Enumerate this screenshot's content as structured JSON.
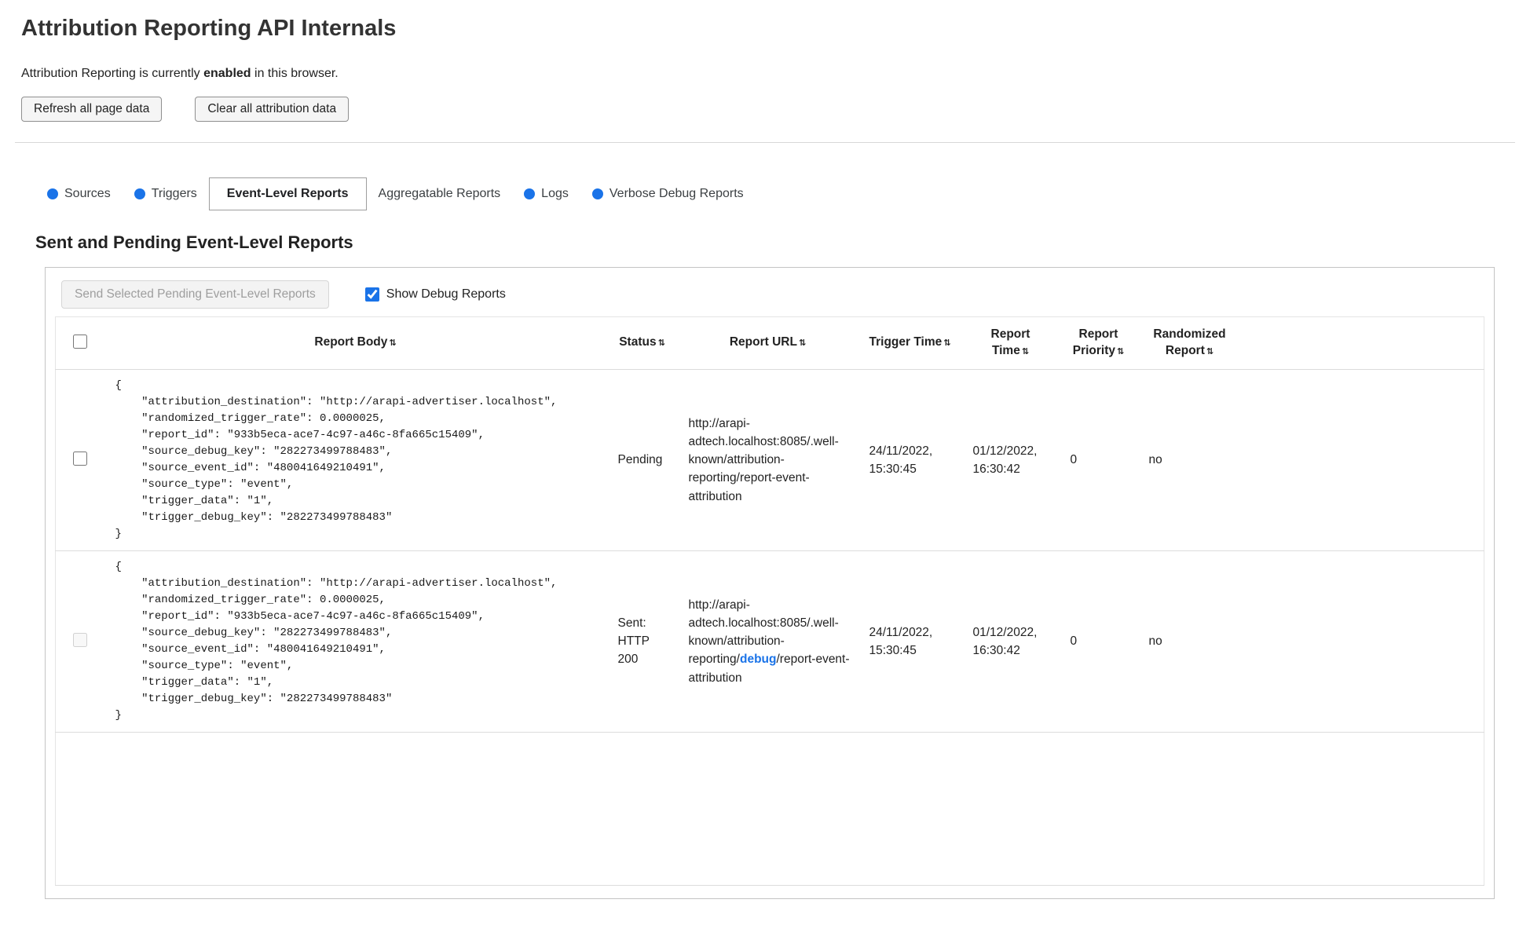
{
  "page": {
    "title": "Attribution Reporting API Internals",
    "status": {
      "prefix": "Attribution Reporting is currently ",
      "bold": "enabled",
      "suffix": " in this browser."
    },
    "buttons": {
      "refresh": "Refresh all page data",
      "clear": "Clear all attribution data"
    }
  },
  "tabs": [
    {
      "label": "Sources"
    },
    {
      "label": "Triggers"
    },
    {
      "label": "Event-Level Reports"
    },
    {
      "label": "Aggregatable Reports"
    },
    {
      "label": "Logs"
    },
    {
      "label": "Verbose Debug Reports"
    }
  ],
  "section": {
    "heading": "Sent and Pending Event-Level Reports",
    "send_button": "Send Selected Pending Event-Level Reports",
    "show_debug_label": "Show Debug Reports",
    "show_debug_checked": true
  },
  "table": {
    "headers": [
      {
        "label": "Report Body",
        "sort": "⇅"
      },
      {
        "label": "Status",
        "sort": "⇅"
      },
      {
        "label": "Report URL",
        "sort": "⇅"
      },
      {
        "label": "Trigger Time",
        "sort": "⇅"
      },
      {
        "label": "Report Time",
        "sort": "⇅"
      },
      {
        "label": "Report Priority",
        "sort": "⇅"
      },
      {
        "label": "Randomized Report",
        "sort": "⇅"
      }
    ],
    "rows": [
      {
        "body": "{\n    \"attribution_destination\": \"http://arapi-advertiser.localhost\",\n    \"randomized_trigger_rate\": 0.0000025,\n    \"report_id\": \"933b5eca-ace7-4c97-a46c-8fa665c15409\",\n    \"source_debug_key\": \"282273499788483\",\n    \"source_event_id\": \"480041649210491\",\n    \"source_type\": \"event\",\n    \"trigger_data\": \"1\",\n    \"trigger_debug_key\": \"282273499788483\"\n}",
        "status": "Pending",
        "url_prefix": "http://arapi-adtech.localhost:8085/.well-known/attribution-reporting/report-event-attribution",
        "url_debug": "",
        "url_suffix": "",
        "trigger_time": "24/11/2022, 15:30:45",
        "report_time": "01/12/2022, 16:30:42",
        "priority": "0",
        "randomized": "no"
      },
      {
        "body": "{\n    \"attribution_destination\": \"http://arapi-advertiser.localhost\",\n    \"randomized_trigger_rate\": 0.0000025,\n    \"report_id\": \"933b5eca-ace7-4c97-a46c-8fa665c15409\",\n    \"source_debug_key\": \"282273499788483\",\n    \"source_event_id\": \"480041649210491\",\n    \"source_type\": \"event\",\n    \"trigger_data\": \"1\",\n    \"trigger_debug_key\": \"282273499788483\"\n}",
        "status": "Sent: HTTP 200",
        "url_prefix": "http://arapi-adtech.localhost:8085/.well-known/attribution-reporting/",
        "url_debug": "debug",
        "url_suffix": "/report-event-attribution",
        "trigger_time": "24/11/2022, 15:30:45",
        "report_time": "01/12/2022, 16:30:42",
        "priority": "0",
        "randomized": "no"
      }
    ]
  },
  "colors": {
    "accent_blue": "#1a73e8",
    "panel_border": "#c4c4c4"
  }
}
